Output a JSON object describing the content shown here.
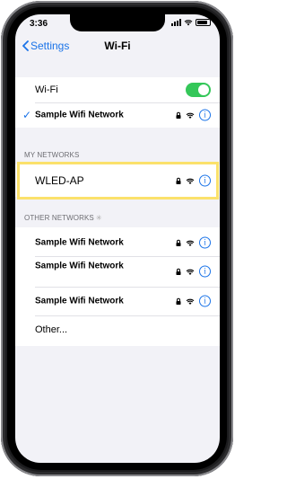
{
  "status": {
    "time": "3:36"
  },
  "nav": {
    "back_label": "Settings",
    "title": "Wi-Fi"
  },
  "wifi": {
    "toggle_label": "Wi-Fi",
    "toggle_on": true,
    "connected_network": "Sample Wifi Network"
  },
  "my_networks": {
    "header": "MY NETWORKS",
    "items": [
      {
        "name": "WLED-AP"
      }
    ]
  },
  "other_networks": {
    "header": "OTHER NETWORKS",
    "items": [
      {
        "name": "Sample Wifi Network"
      },
      {
        "name": "Sample Wifi Network"
      },
      {
        "name": "Sample Wifi Network"
      }
    ],
    "other_label": "Other..."
  },
  "colors": {
    "accent": "#1a73e8",
    "toggle_on": "#34c759",
    "highlight": "#fbe16b",
    "background": "#f2f2f7"
  },
  "icons": {
    "lock": "lock-icon",
    "wifi": "wifi-icon",
    "info": "info-icon"
  }
}
